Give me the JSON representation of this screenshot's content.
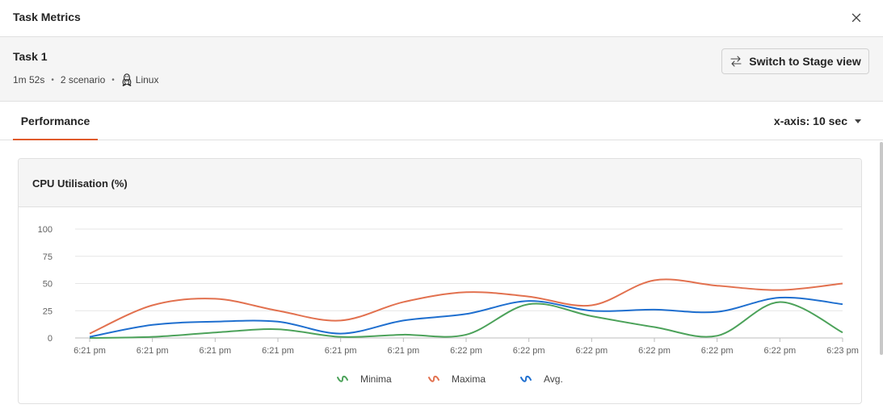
{
  "dialog": {
    "title": "Task Metrics"
  },
  "task": {
    "name": "Task 1",
    "duration": "1m 52s",
    "scenarios": "2 scenario",
    "os": "Linux",
    "switch_label": "Switch to Stage view"
  },
  "tabs": [
    {
      "label": "Performance",
      "active": true
    }
  ],
  "xaxis_selector": {
    "label": "x-axis: 10 sec"
  },
  "colors": {
    "accent": "#e05a2b",
    "minima": "#4ca25a",
    "maxima": "#e2714f",
    "avg": "#1f6fcf"
  },
  "chart_data": {
    "type": "line",
    "title": "CPU Utilisation (%)",
    "xlabel": "",
    "ylabel": "",
    "ylim": [
      0,
      100
    ],
    "yticks": [
      "0",
      "25",
      "50",
      "75",
      "100"
    ],
    "categories": [
      "6:21 pm",
      "6:21 pm",
      "6:21 pm",
      "6:21 pm",
      "6:21 pm",
      "6:21 pm",
      "6:22 pm",
      "6:22 pm",
      "6:22 pm",
      "6:22 pm",
      "6:22 pm",
      "6:22 pm",
      "6:23 pm"
    ],
    "series": [
      {
        "name": "Minima",
        "color": "#4ca25a",
        "values": [
          0,
          1,
          5,
          8,
          1,
          3,
          3,
          31,
          20,
          10,
          2,
          33,
          5
        ]
      },
      {
        "name": "Maxima",
        "color": "#e2714f",
        "values": [
          4,
          30,
          36,
          25,
          16,
          33,
          42,
          38,
          30,
          53,
          48,
          44,
          50
        ]
      },
      {
        "name": "Avg.",
        "color": "#1f6fcf",
        "values": [
          1,
          12,
          15,
          15,
          4,
          16,
          22,
          34,
          25,
          26,
          24,
          37,
          31
        ]
      }
    ],
    "grid": true,
    "legend_position": "bottom-center"
  }
}
